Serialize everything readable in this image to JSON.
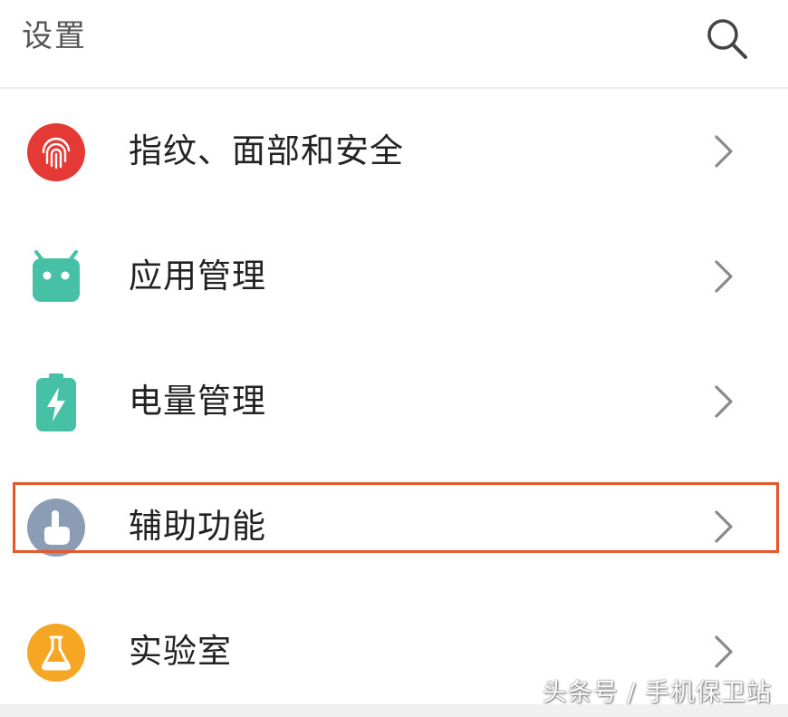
{
  "header": {
    "title": "设置",
    "search_icon": "search-icon"
  },
  "settings_items": [
    {
      "label": "指纹、面部和安全",
      "icon": "fingerprint-icon",
      "color": "#e53935"
    },
    {
      "label": "应用管理",
      "icon": "android-app-icon",
      "color": "#47c1a6"
    },
    {
      "label": "电量管理",
      "icon": "battery-icon",
      "color": "#47c1a6"
    },
    {
      "label": "辅助功能",
      "icon": "hand-pointer-icon",
      "color": "#8b9db4"
    },
    {
      "label": "实验室",
      "icon": "flask-icon",
      "color": "#f5a623"
    }
  ],
  "highlighted_item": "辅助功能",
  "highlight_color": "#e4582c",
  "watermark": "头条号 / 手机保卫站"
}
